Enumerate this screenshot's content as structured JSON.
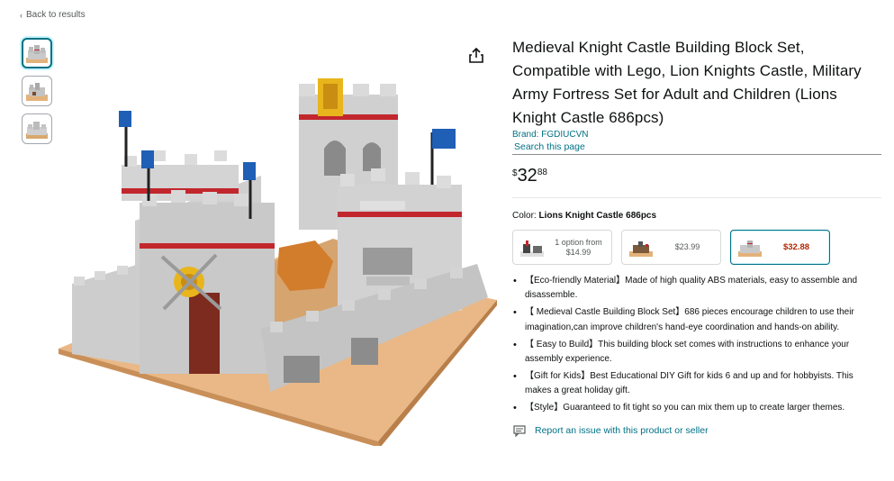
{
  "nav": {
    "back_label": "Back to results",
    "back_chevron": "‹"
  },
  "thumbnails": [
    {
      "icon": "castle-thumbnail-1",
      "active": true
    },
    {
      "icon": "castle-thumbnail-2",
      "active": false
    },
    {
      "icon": "castle-thumbnail-3",
      "active": false
    }
  ],
  "share_icon": "share-icon",
  "product": {
    "title": "Medieval Knight Castle Building Block Set, Compatible with Lego, Lion Knights Castle, Military Army Fortress Set for Adult and Children (Lions Knight Castle 686pcs)",
    "brand": "Brand: FGDIUCVN",
    "search_page": "Search this page",
    "price": {
      "symbol": "$",
      "whole": "32",
      "fraction": "88"
    },
    "color_label": "Color:",
    "color_value": "Lions Knight Castle 686pcs",
    "options": [
      {
        "text": "1 option from $14.99",
        "selected": false
      },
      {
        "text": "$23.99",
        "selected": false
      },
      {
        "text": "$32.88",
        "selected": true
      }
    ],
    "bullets": [
      "【Eco-friendly Material】Made of high quality ABS materials, easy to assemble and disassemble.",
      "【 Medieval Castle Building Block Set】686 pieces encourage children to use their imagination,can improve children's hand-eye coordination and hands-on ability.",
      "【 Easy to Build】This building block set comes with instructions to enhance your assembly experience.",
      "【Gift for Kids】Best Educational DIY Gift for kids 6 and up and for hobbyists. This makes a great holiday gift.",
      "【Style】Guaranteed to fit tight so you can mix them up to create larger themes."
    ],
    "report_label": "Report an issue with this product or seller"
  },
  "colors": {
    "link": "#007185",
    "price_red": "#b12704",
    "text": "#0f1111",
    "muted": "#565959"
  }
}
